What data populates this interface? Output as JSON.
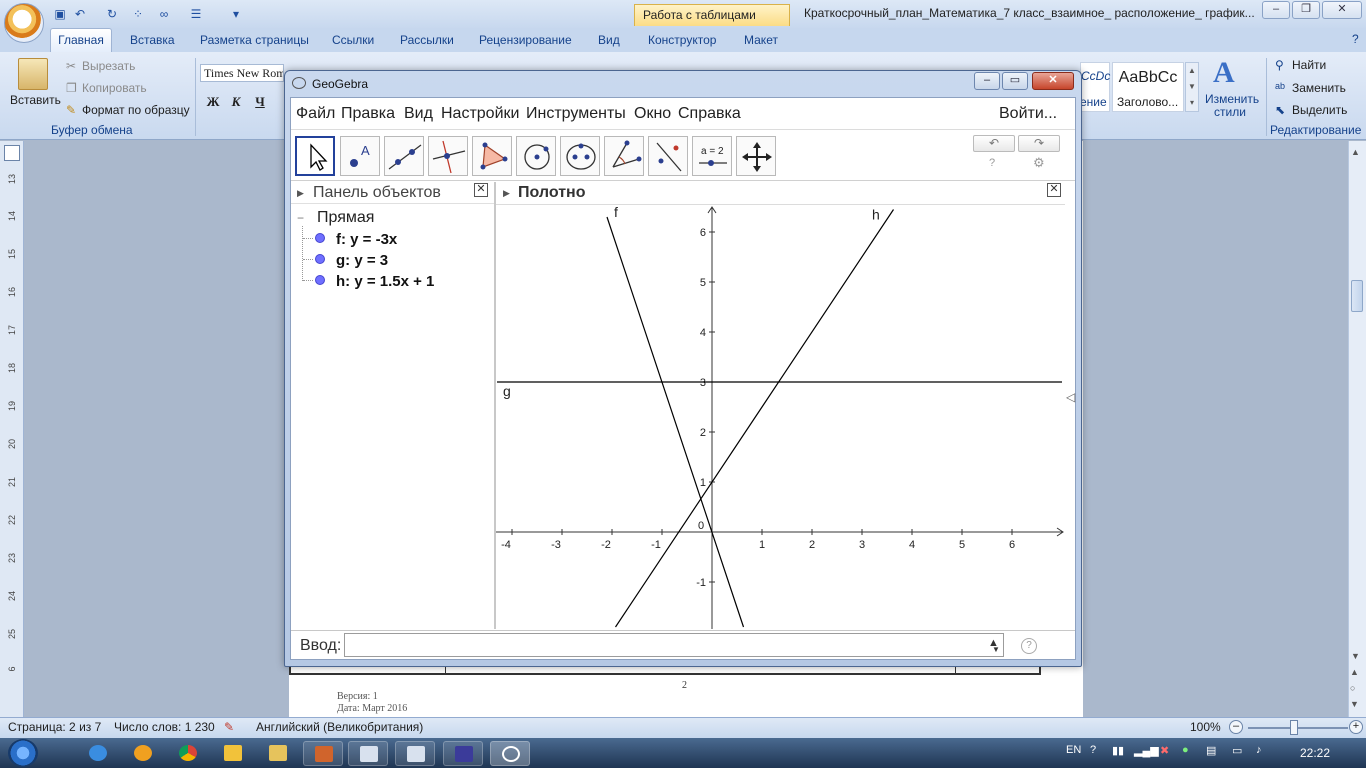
{
  "word": {
    "contextual_tab": "Работа с таблицами",
    "doc_title": "Краткосрочный_план_Математика_7 класс_взаимное_ расположение_ график...",
    "tabs": [
      "Главная",
      "Вставка",
      "Разметка страницы",
      "Ссылки",
      "Рассылки",
      "Рецензирование",
      "Вид",
      "Конструктор",
      "Макет"
    ],
    "clipboard": {
      "paste": "Вставить",
      "cut": "Вырезать",
      "copy": "Копировать",
      "format_painter": "Формат по образцу",
      "group_label": "Буфер обмена"
    },
    "font": {
      "name": "Times New Rom",
      "bold": "Ж",
      "italic": "К",
      "underline": "Ч"
    },
    "styles": {
      "style1": "ение",
      "style1_top": "CcDc",
      "style2": "AaBbCc",
      "style2_label": "Заголово...",
      "change_styles": "Изменить",
      "change_styles2": "стили"
    },
    "editing": {
      "find": "Найти",
      "replace": "Заменить",
      "select": "Выделить",
      "group_label": "Редактирование"
    },
    "ruler_numbers": [
      "13",
      "14",
      "15",
      "16",
      "17",
      "18",
      "19",
      "20",
      "21",
      "22",
      "23",
      "24",
      "25",
      "6"
    ],
    "page_number": "2",
    "footer": {
      "version": "Версия:  1",
      "date": "Дата: Март 2016"
    },
    "status": {
      "page": "Страница: 2 из 7",
      "words": "Число слов: 1 230",
      "language": "Английский (Великобритания)",
      "zoom": "100%"
    }
  },
  "taskbar": {
    "lang": "EN",
    "clock": "22:22"
  },
  "geogebra": {
    "title": "GeoGebra",
    "menu": [
      "Файл",
      "Правка",
      "Вид",
      "Настройки",
      "Инструменты",
      "Окно",
      "Справка"
    ],
    "login": "Войти...",
    "tool_equation_label": "a = 2",
    "algebra": {
      "title": "Панель объектов",
      "group": "Прямая",
      "items": [
        "f: y = -3x",
        "g: y = 3",
        "h: y = 1.5x + 1"
      ]
    },
    "graphics": {
      "title": "Полотно",
      "x_ticks": [
        "-4",
        "-3",
        "-2",
        "-1",
        "0",
        "1",
        "2",
        "3",
        "4",
        "5",
        "6"
      ],
      "y_ticks": [
        "6",
        "5",
        "4",
        "3",
        "2",
        "1",
        "-1"
      ],
      "line_labels": [
        "f",
        "g",
        "h"
      ],
      "line_color": "#000000"
    },
    "input": {
      "label": "Ввод:",
      "value": "",
      "help": "?"
    }
  },
  "chart_data": {
    "type": "line",
    "xlim": [
      -4.3,
      7.0
    ],
    "ylim": [
      -1.9,
      6.5
    ],
    "grid": false,
    "series": [
      {
        "name": "f",
        "expr": "y = -3x",
        "x": [
          -2.1,
          0.63
        ],
        "y": [
          6.3,
          -1.9
        ]
      },
      {
        "name": "g",
        "expr": "y = 3",
        "x": [
          -4.3,
          7.0
        ],
        "y": [
          3,
          3
        ]
      },
      {
        "name": "h",
        "expr": "y = 1.5x + 1",
        "x": [
          -1.93,
          3.63
        ],
        "y": [
          -1.9,
          6.45
        ]
      }
    ]
  }
}
